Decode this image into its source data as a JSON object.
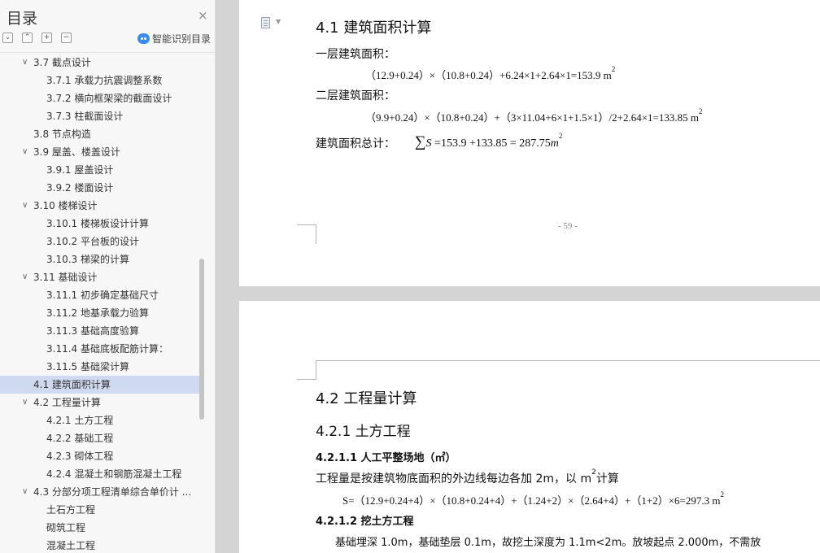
{
  "sidebar": {
    "title": "目录",
    "close_icon": "×",
    "tools": [
      "⌄",
      "⌃",
      "+",
      "−"
    ],
    "ai_label": "智能识别目录",
    "items": [
      {
        "label": "3.7  截点设计",
        "level": 1,
        "expanded": true
      },
      {
        "label": "3.7.1  承载力抗震调整系数",
        "level": 2
      },
      {
        "label": "3.7.2  横向框架梁的截面设计",
        "level": 2
      },
      {
        "label": "3.7.3  柱截面设计",
        "level": 2
      },
      {
        "label": "3.8  节点构造",
        "level": 1
      },
      {
        "label": "3.9  屋盖、楼盖设计",
        "level": 1,
        "expanded": true
      },
      {
        "label": "3.9.1  屋盖设计",
        "level": 2
      },
      {
        "label": "3.9.2  楼面设计",
        "level": 2
      },
      {
        "label": "3.10  楼梯设计",
        "level": 1,
        "expanded": true
      },
      {
        "label": "3.10.1  楼梯板设计计算",
        "level": 2
      },
      {
        "label": "3.10.2  平台板的设计",
        "level": 2
      },
      {
        "label": "3.10.3  梯梁的计算",
        "level": 2
      },
      {
        "label": "3.11  基础设计",
        "level": 1,
        "expanded": true
      },
      {
        "label": "3.11.1  初步确定基础尺寸",
        "level": 2
      },
      {
        "label": "3.11.2  地基承载力验算",
        "level": 2
      },
      {
        "label": "3.11.3  基础高度验算",
        "level": 2
      },
      {
        "label": "3.11.4  基础底板配筋计算：",
        "level": 2
      },
      {
        "label": "3.11.5 基础梁计算",
        "level": 2
      },
      {
        "label": "4.1  建筑面积计算",
        "level": 1,
        "active": true
      },
      {
        "label": "4.2  工程量计算",
        "level": 1,
        "expanded": true
      },
      {
        "label": "4.2.1  土方工程",
        "level": 2
      },
      {
        "label": "4.2.2  基础工程",
        "level": 2
      },
      {
        "label": "4.2.3  砌体工程",
        "level": 2
      },
      {
        "label": "4.2.4  混凝土和钢筋混凝土工程",
        "level": 2
      },
      {
        "label": "4.3  分部分项工程清单综合单价计 ...",
        "level": 1,
        "expanded": true
      },
      {
        "label": "土石方工程",
        "level": 2
      },
      {
        "label": "砌筑工程",
        "level": 2
      },
      {
        "label": "混凝土工程",
        "level": 2
      }
    ]
  },
  "doc": {
    "page1": {
      "heading": "4.1  建筑面积计算",
      "floor1_label": "一层建筑面积：",
      "floor1_formula": "（12.9+0.24）×（10.8+0.24）+6.24×1+2.64×1=153.9 m",
      "floor2_label": "二层建筑面积：",
      "floor2_formula": "（9.9+0.24）×（10.8+0.24）+（3×11.04+6×1+1.5×1）/2+2.64×1=133.85 m",
      "total_label": "建筑面积总计：",
      "total_sum": "∑",
      "total_var": "S",
      "total_formula": " =153.9 +133.85 = 287.75",
      "total_unit": "m",
      "sup2": "2",
      "page_number": "- 59 -"
    },
    "page2": {
      "heading": "4.2  工程量计算",
      "sub1": "4.2.1  土方工程",
      "sub2": "4.2.1.1  人工平整场地（㎡）",
      "para1_a": "工程量是按建筑物底面积的外边线每边各加 2m，以 m",
      "para1_b": "计算",
      "formula": "S=（12.9+0.24+4）×（10.8+0.24+4）+（1.24+2）×（2.64+4）+（1+2）×6=297.3  m",
      "sub3": "4.2.1.2  挖土方工程",
      "para2": "基础埋深 1.0m，基础垫层 0.1m，故挖土深度为 1.1m<2m。放坡起点 2.000m，不需放"
    }
  }
}
